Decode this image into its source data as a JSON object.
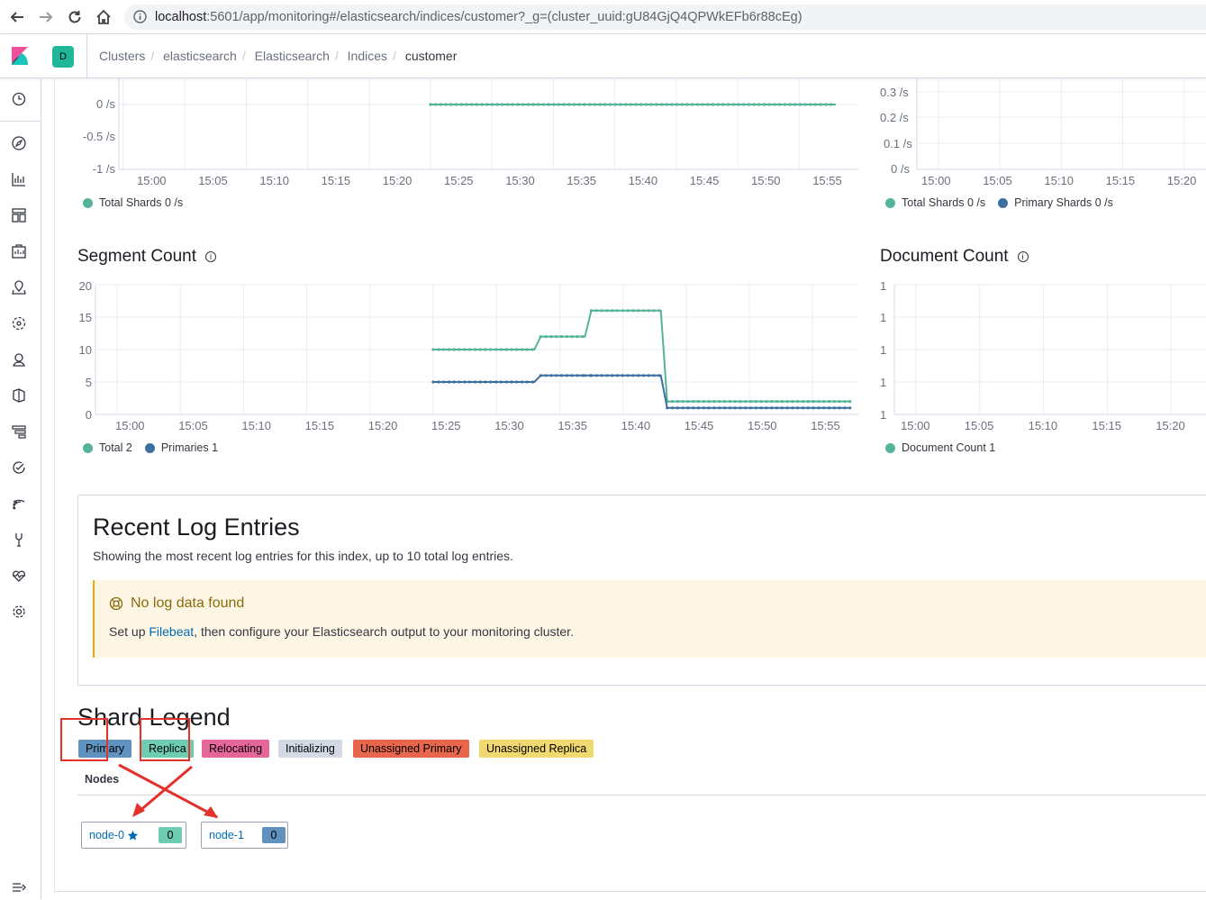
{
  "browser": {
    "url_host": "localhost",
    "url_rest": ":5601/app/monitoring#/elasticsearch/indices/customer?_g=(cluster_uuid:gU84GjQ4QPWkEFb6r88cEg)"
  },
  "header": {
    "space_letter": "D",
    "breadcrumbs": [
      "Clusters",
      "elasticsearch",
      "Elasticsearch",
      "Indices",
      "customer"
    ]
  },
  "sidebar_icons": [
    "clock-icon",
    "compass-icon",
    "visualize-icon",
    "dashboard-icon",
    "canvas-icon",
    "maps-icon",
    "ml-icon",
    "infrastructure-icon",
    "logs-icon",
    "apm-icon",
    "uptime-icon",
    "siem-icon",
    "devtools-icon",
    "monitoring-icon",
    "management-icon",
    "collapse-icon"
  ],
  "charts": {
    "top_left": {
      "y_ticks": [
        "0 /s",
        "-0.5 /s",
        "-1 /s"
      ],
      "x_ticks": [
        "15:00",
        "15:05",
        "15:10",
        "15:15",
        "15:20",
        "15:25",
        "15:30",
        "15:35",
        "15:40",
        "15:45",
        "15:50",
        "15:55"
      ],
      "legend": [
        {
          "label": "Total Shards 0 /s",
          "color": "#54b399"
        }
      ]
    },
    "top_right": {
      "y_ticks": [
        "0.3 /s",
        "0.2 /s",
        "0.1 /s",
        "0 /s"
      ],
      "x_ticks": [
        "15:00",
        "15:05",
        "15:10",
        "15:15",
        "15:20"
      ],
      "legend": [
        {
          "label": "Total Shards 0 /s",
          "color": "#54b399"
        },
        {
          "label": "Primary Shards 0 /s",
          "color": "#3b6fa0"
        }
      ]
    },
    "segment": {
      "title": "Segment Count",
      "y_ticks": [
        "20",
        "15",
        "10",
        "5",
        "0"
      ],
      "x_ticks": [
        "15:00",
        "15:05",
        "15:10",
        "15:15",
        "15:20",
        "15:25",
        "15:30",
        "15:35",
        "15:40",
        "15:45",
        "15:50",
        "15:55"
      ],
      "legend": [
        {
          "label": "Total 2",
          "color": "#54b399"
        },
        {
          "label": "Primaries 1",
          "color": "#3b6fa0"
        }
      ]
    },
    "document": {
      "title": "Document Count",
      "y_ticks": [
        "1",
        "1",
        "1",
        "1",
        "1"
      ],
      "x_ticks": [
        "15:00",
        "15:05",
        "15:10",
        "15:15",
        "15:20"
      ],
      "legend": [
        {
          "label": "Document Count 1",
          "color": "#54b399"
        }
      ]
    }
  },
  "chart_data": [
    {
      "type": "line",
      "x": [
        "15:25",
        "15:58"
      ],
      "series": [
        {
          "name": "Total Shards",
          "values": [
            0,
            0
          ]
        }
      ],
      "ylim": [
        -1,
        0.2
      ]
    },
    {
      "type": "line",
      "categories": [
        "15:25",
        "15:33",
        "15:33.5",
        "15:37",
        "15:37.5",
        "15:43",
        "15:43.5",
        "15:58"
      ],
      "series": [
        {
          "name": "Total",
          "values": [
            10,
            10,
            12,
            12,
            16,
            16,
            2,
            2
          ]
        },
        {
          "name": "Primaries",
          "values": [
            5,
            5,
            6,
            6,
            6,
            6,
            1,
            1
          ]
        }
      ],
      "ylim": [
        0,
        20
      ]
    }
  ],
  "logs": {
    "title": "Recent Log Entries",
    "description": "Showing the most recent log entries for this index, up to 10 total log entries.",
    "callout_title": "No log data found",
    "callout_prefix": "Set up ",
    "callout_link": "Filebeat",
    "callout_suffix": ", then configure your Elasticsearch output to your monitoring cluster."
  },
  "shard_legend": {
    "title": "Shard Legend",
    "badges": [
      {
        "label": "Primary",
        "color": "#6092c0"
      },
      {
        "label": "Replica",
        "color": "#6dccb1"
      },
      {
        "label": "Relocating",
        "color": "#e7664c"
      },
      {
        "label": "Initializing",
        "color": "#d3dae6"
      },
      {
        "label": "Unassigned Primary",
        "color": "#e7664c"
      },
      {
        "label": "Unassigned Replica",
        "color": "#f1d86f"
      }
    ],
    "nodes_header": "Nodes",
    "nodes": [
      {
        "name": "node-0",
        "count": "0",
        "count_color": "#6dccb1",
        "master": true
      },
      {
        "name": "node-1",
        "count": "0",
        "count_color": "#6092c0",
        "master": false
      }
    ]
  }
}
